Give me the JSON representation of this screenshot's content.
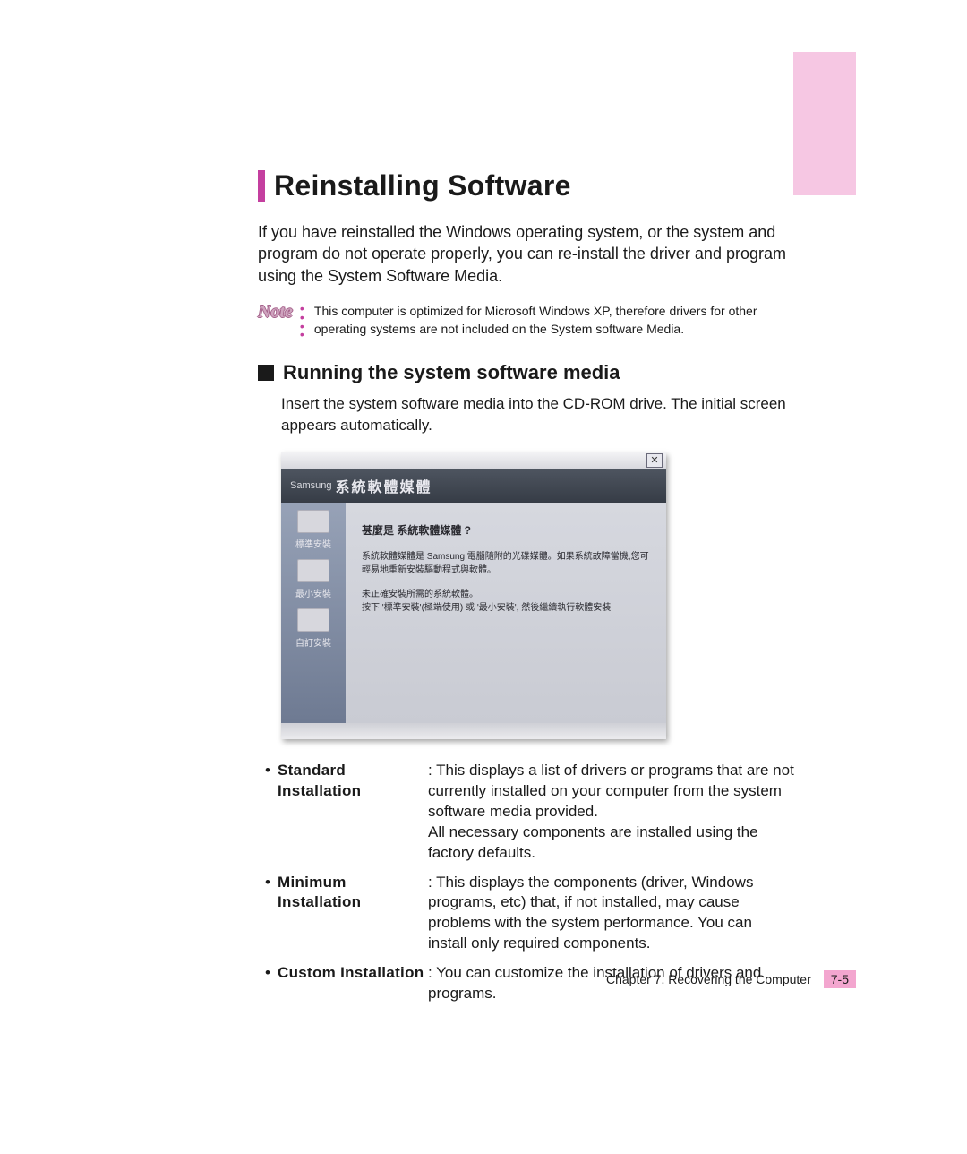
{
  "heading": "Reinstalling Software",
  "intro": "If you have reinstalled the Windows operating system, or the system and program do not operate properly, you can re-install the driver and program using the System Software Media.",
  "note": {
    "word": "Note",
    "text": "This computer is optimized for Microsoft Windows XP, therefore drivers for other operating systems are not included on the System software Media."
  },
  "subheading": "Running the system software media",
  "subpara": "Insert the system software media into the CD-ROM drive. The initial screen appears automatically.",
  "screenshot": {
    "brand": "Samsung",
    "title_zh": "系統軟體媒體",
    "close": "✕",
    "side_items": [
      "標準安裝",
      "最小安裝",
      "自訂安裝"
    ],
    "q": "甚麼是 系統軟體媒體 ?",
    "p1": "系統軟體媒體是 Samsung 電腦隨附的光碟媒體。如果系統故障當機,您可輕易地重新安裝驅動程式與軟體。",
    "p2a": "未正確安裝所需的系統軟體。",
    "p2b": "按下 '標準安裝'(極端使用) 或 '最小安裝', 然後繼續執行軟體安裝"
  },
  "install": {
    "standard": {
      "label": "Standard Installation",
      "desc": ": This displays a list of drivers or programs that are not currently installed on your computer from the system software media provided.",
      "desc2": "All necessary components are installed using the factory defaults."
    },
    "minimum": {
      "label": "Minimum Installation",
      "desc": ": This displays the components (driver, Windows programs, etc) that, if not installed, may cause problems with the system performance. You can install only required components."
    },
    "custom": {
      "label": "Custom Installation",
      "desc": ": You can customize the installation of drivers and programs."
    }
  },
  "footer": {
    "chapter": "Chapter 7. Recovering the Computer",
    "page": "7-5"
  },
  "bullet": "•"
}
